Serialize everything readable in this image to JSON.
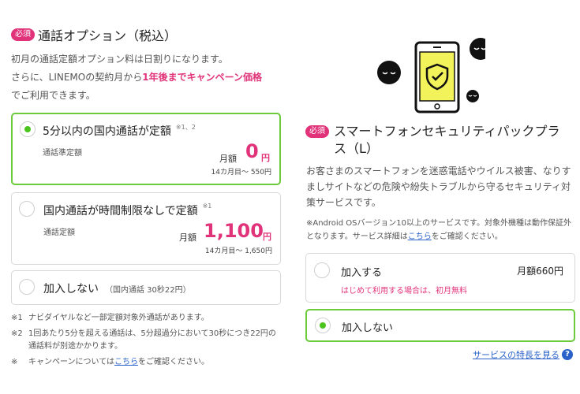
{
  "left": {
    "required_label": "必須",
    "title": "通話オプション（税込）",
    "desc_line1": "初月の通話定額オプション料は日割りになります。",
    "desc_line2_pre": "さらに、LINEMOの契約月から",
    "desc_line2_pink": "1年後までキャンペーン価格",
    "desc_line3": "でご利用できます。",
    "options": [
      {
        "label": "5分以内の国内通話が定額",
        "sup": "※1、2",
        "sub": "通話準定額",
        "price_prefix": "月額",
        "price": "0",
        "price_unit": "円",
        "price_note": "14カ月目～ 550円"
      },
      {
        "label": "国内通話が時間制限なしで定額",
        "sup": "※1",
        "sub": "通話定額",
        "price_prefix": "月額",
        "price": "1,100",
        "price_unit": "円",
        "price_note": "14カ月目～ 1,650円"
      },
      {
        "label": "加入しない",
        "note": "（国内通話 30秒22円）"
      }
    ],
    "footnotes": [
      {
        "mark": "※1",
        "text": "ナビダイヤルなど一部定額対象外通話があります。"
      },
      {
        "mark": "※2",
        "text": "1回あたり5分を超える通話は、5分超過分において30秒につき22円の通話料が別途かかります。"
      },
      {
        "mark": "※",
        "text_pre": "キャンペーンについては",
        "link": "こちら",
        "text_post": "をご確認ください。"
      }
    ]
  },
  "right": {
    "required_label": "必須",
    "title_line1": "スマートフォンセキュリティパックプラ",
    "title_line2": "ス（L）",
    "desc": "お客さまのスマートフォンを迷惑電話やウイルス被害、なりすましサイトなどの危険や紛失トラブルから守るセキュリティ対策サービスです。",
    "note_pre": "※Android OSバージョン10以上のサービスです。対象外機種は動作保証外となります。サービス詳細は",
    "note_link": "こちら",
    "note_post": "をご確認ください。",
    "options": [
      {
        "label": "加入する",
        "price": "月額660円",
        "sub": "はじめて利用する場合は、初月無料"
      },
      {
        "label": "加入しない"
      }
    ],
    "help_link": "サービスの特長を見る",
    "help_icon": "?"
  },
  "selection": {
    "call_option": "5分以内の国内通話が定額",
    "security_pack": "加入しない"
  },
  "colors": {
    "accent_pink": "#e0337a",
    "selected_green": "#6bcb3a",
    "radio_green": "#4cc420",
    "link_blue": "#2a62c9",
    "phone_screen": "#f2f25a"
  },
  "icons": [
    "phone-shield-illustration",
    "virus-face-icon",
    "help-icon"
  ]
}
